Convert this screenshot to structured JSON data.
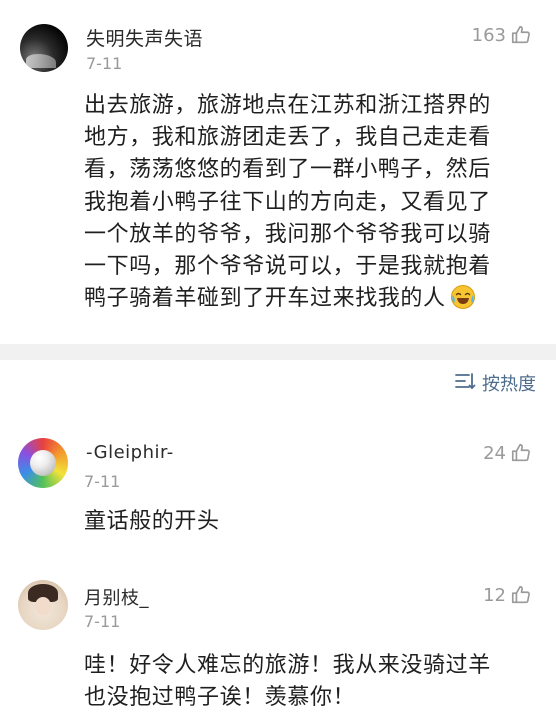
{
  "post": {
    "username": "失明失声失语",
    "date": "7-11",
    "likes": "163",
    "lines": [
      "出去旅游，旅游地点在江苏和浙江搭界的",
      "地方，我和旅游团走丢了，我自己走走看",
      "看，荡荡悠悠的看到了一群小鸭子，然后",
      "我抱着小鸭子往下山的方向走，又看见了",
      "一个放羊的爷爷，我问那个爷爷我可以骑",
      "一下吗，那个爷爷说可以，于是我就抱着",
      "鸭子骑着羊碰到了开车过来找我的人"
    ],
    "emoji": "laugh-cry-emoji"
  },
  "sort": {
    "label": "按热度",
    "icon": "sort-lines-icon"
  },
  "comments": [
    {
      "username": "-Gleiphir-",
      "date": "7-11",
      "likes": "24",
      "lines": [
        "童话般的开头"
      ]
    },
    {
      "username": "月别枝_",
      "date": "7-11",
      "likes": "12",
      "lines": [
        "哇！好令人难忘的旅游！我从来没骑过羊",
        "也没抱过鸭子诶！羡慕你！"
      ]
    }
  ],
  "colors": {
    "link": "#4d6d8d",
    "muted": "#9a9a9a",
    "text": "#1f1f1f",
    "divider": "#f1f1f1"
  }
}
